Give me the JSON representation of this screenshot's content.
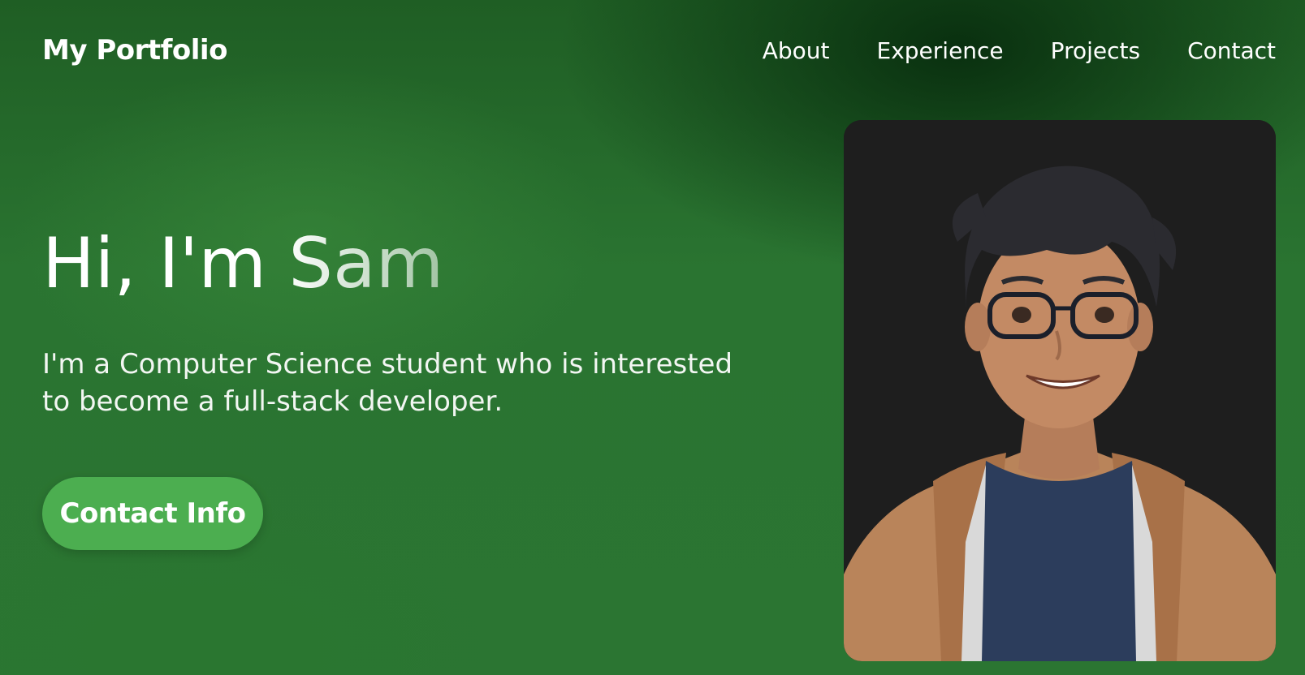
{
  "nav": {
    "brand": "My Portfolio",
    "links": [
      "About",
      "Experience",
      "Projects",
      "Contact"
    ]
  },
  "hero": {
    "title": "Hi, I'm Sam",
    "subtitle": "I'm a Computer Science student who is interested to become a full-stack developer.",
    "cta_label": "Contact Info"
  },
  "colors": {
    "background": "#2a7431",
    "accent": "#4cae50",
    "portrait_bg": "#1e1e1e"
  },
  "portrait": {
    "icon": "avatar-illustration"
  }
}
